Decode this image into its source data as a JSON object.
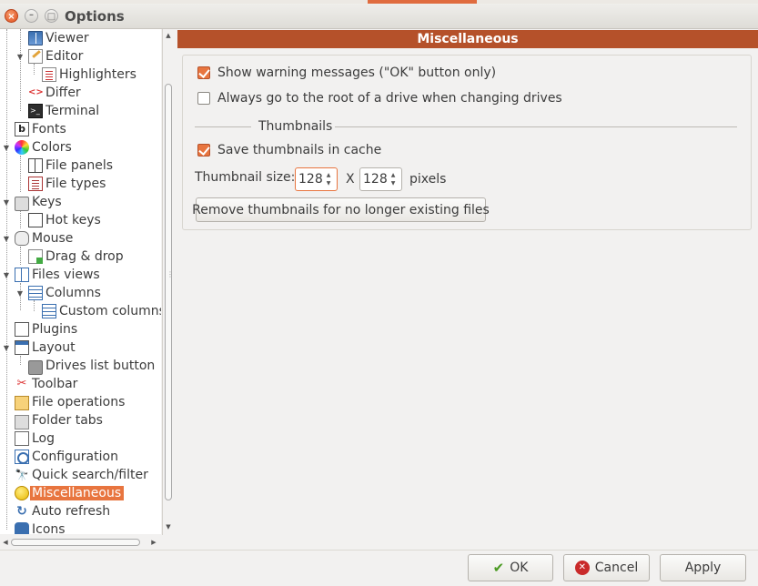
{
  "window": {
    "title": "Options",
    "close_glyph": "×",
    "min_glyph": "–",
    "max_glyph": "□"
  },
  "tree": {
    "items": [
      {
        "label": "Viewer",
        "icon": "book-icon"
      },
      {
        "label": "Editor",
        "icon": "edit-icon"
      },
      {
        "label": "Highlighters",
        "icon": "document-icon"
      },
      {
        "label": "Differ",
        "icon": "diff-icon"
      },
      {
        "label": "Terminal",
        "icon": "terminal-icon"
      },
      {
        "label": "Fonts",
        "icon": "font-icon"
      },
      {
        "label": "Colors",
        "icon": "color-wheel-icon"
      },
      {
        "label": "File panels",
        "icon": "panels-icon"
      },
      {
        "label": "File types",
        "icon": "filetype-icon"
      },
      {
        "label": "Keys",
        "icon": "keyboard-icon"
      },
      {
        "label": "Hot keys",
        "icon": "hotkey-icon"
      },
      {
        "label": "Mouse",
        "icon": "mouse-icon"
      },
      {
        "label": "Drag & drop",
        "icon": "drag-drop-icon"
      },
      {
        "label": "Files views",
        "icon": "files-views-icon"
      },
      {
        "label": "Columns",
        "icon": "columns-icon"
      },
      {
        "label": "Custom columns",
        "icon": "custom-columns-icon"
      },
      {
        "label": "Plugins",
        "icon": "plugin-icon"
      },
      {
        "label": "Layout",
        "icon": "layout-icon"
      },
      {
        "label": "Drives list button",
        "icon": "drive-icon"
      },
      {
        "label": "Toolbar",
        "icon": "toolbar-icon"
      },
      {
        "label": "File operations",
        "icon": "folder-icon"
      },
      {
        "label": "Folder tabs",
        "icon": "tabs-icon"
      },
      {
        "label": "Log",
        "icon": "log-icon"
      },
      {
        "label": "Configuration",
        "icon": "config-icon"
      },
      {
        "label": "Quick search/filter",
        "icon": "search-icon"
      },
      {
        "label": "Miscellaneous",
        "icon": "misc-icon",
        "selected": true
      },
      {
        "label": "Auto refresh",
        "icon": "refresh-icon"
      },
      {
        "label": "Icons",
        "icon": "icons-icon"
      }
    ],
    "expander_glyph": "▼"
  },
  "main": {
    "header": "Miscellaneous",
    "show_warning": {
      "label": "Show warning messages (\"OK\" button only)",
      "checked": true
    },
    "goto_root": {
      "label": "Always go to the root of a drive when changing drives",
      "checked": false
    },
    "thumbnails_title": "Thumbnails",
    "save_thumbnails": {
      "label": "Save thumbnails in cache",
      "checked": true
    },
    "thumbnail_size_label": "Thumbnail size:",
    "width_value": "128",
    "height_value": "128",
    "x_label": "X",
    "pixels_label": "pixels",
    "remove_button": "Remove thumbnails for no longer existing files"
  },
  "buttons": {
    "ok": "OK",
    "cancel": "Cancel",
    "apply": "Apply"
  },
  "colors": {
    "accent": "#e8753f",
    "header": "#b5512a"
  }
}
